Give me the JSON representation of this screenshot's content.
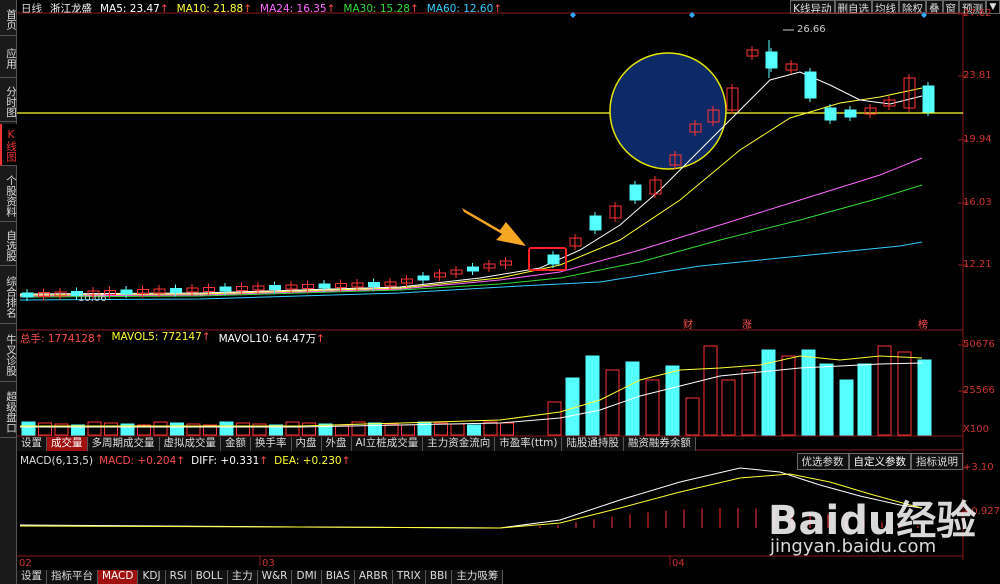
{
  "sidebar": [
    {
      "label": "首页"
    },
    {
      "label": "应用"
    },
    {
      "label": "分时图"
    },
    {
      "label": "K线图",
      "active": true
    },
    {
      "label": "个股资料"
    },
    {
      "label": "自选股"
    },
    {
      "label": "综合排名"
    },
    {
      "label": "牛叉诊股"
    },
    {
      "label": "超级盘口"
    }
  ],
  "header": {
    "period": "日线",
    "name": "浙江龙盛",
    "ma5": "MA5: 23.47",
    "ma10": "MA10: 21.88",
    "ma24": "MA24: 16.35",
    "ma30": "MA30: 15.28",
    "ma60": "MA60: 12.60"
  },
  "top_buttons": [
    "K线异动",
    "删自选",
    "均线",
    "除权",
    "叠",
    "窗",
    "预测"
  ],
  "price_axis": [
    "27.62",
    "23.81",
    "19.94",
    "16.03",
    "12.21"
  ],
  "price_labels": {
    "high": "26.66",
    "low": "10.06",
    "event_cai": "财",
    "event_zhang": "涨",
    "event_bang": "榜"
  },
  "volume_header": {
    "total": "总手: 1774128",
    "mavol5": "MAVOL5: 772147",
    "mavol10": "MAVOL10: 64.47万"
  },
  "volume_axis": [
    "50676",
    "25566",
    "X100"
  ],
  "volume_tabs": [
    "设置",
    "成交量",
    "多周期成交量",
    "虚拟成交量",
    "金额",
    "换手率",
    "内盘",
    "外盘",
    "AI立桩成交量",
    "主力资金流向",
    "市盈率(ttm)",
    "陆股通持股",
    "融资融券余额"
  ],
  "macd_header": {
    "name": "MACD(6,13,5)",
    "macd": "MACD: +0.204",
    "diff": "DIFF: +0.331",
    "dea": "DEA: +0.230"
  },
  "macd_buttons": [
    "优选参数",
    "自定义参数",
    "指标说明"
  ],
  "macd_axis": [
    "+3.10",
    "+0.927"
  ],
  "date_axis": [
    "02",
    "03",
    "04"
  ],
  "bottom_tabs": [
    "设置",
    "指标平台",
    "MACD",
    "KDJ",
    "RSI",
    "BOLL",
    "主力",
    "W&R",
    "DMI",
    "BIAS",
    "ARBR",
    "TRIX",
    "BBI",
    "主力吸筹"
  ],
  "watermark": {
    "brand": "Baidu经验",
    "url": "jingyan.baidu.com"
  },
  "colors": {
    "up": "#ff3333",
    "down": "#55ffff",
    "ma5": "#ffffff",
    "ma10": "#ffff33",
    "ma24": "#ff66ff",
    "ma30": "#33dd33",
    "ma60": "#33ccff",
    "grid": "#8a1a1a"
  }
}
